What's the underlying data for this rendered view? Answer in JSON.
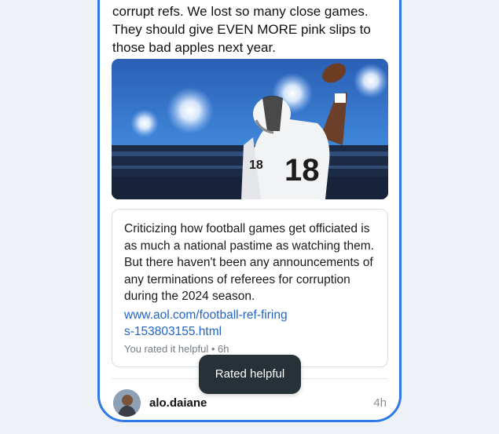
{
  "post": {
    "text": "corrupt refs. We lost so many close games. They should give EVEN MORE pink slips to those bad apples next year."
  },
  "photo": {
    "jersey_number": "18"
  },
  "note": {
    "text": "Criticizing how football games get officiated is as much a national pastime as watching them. But there haven't been any announcements of any terminations of referees for corruption during the 2024 season.",
    "link": "www.aol.com/football-ref-firings-153803155.html",
    "meta": "You rated it helpful • 6h"
  },
  "next_post": {
    "username": "alo.daiane",
    "time": "4h"
  },
  "toast": {
    "label": "Rated helpful"
  },
  "colors": {
    "frame": "#2f7be6",
    "link": "#2164c7",
    "toast_bg": "#263238"
  }
}
